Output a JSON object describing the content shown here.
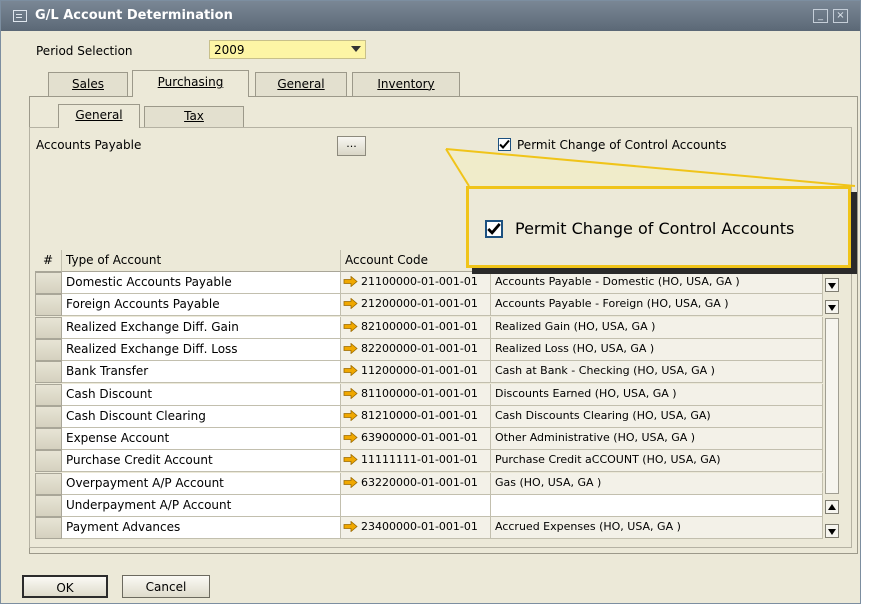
{
  "window": {
    "title": "G/L Account Determination",
    "controls": [
      "_",
      "×"
    ]
  },
  "period": {
    "label": "Period Selection",
    "value": "2009"
  },
  "tabs": [
    {
      "label": "Sales",
      "active": false
    },
    {
      "label": "Purchasing",
      "active": true
    },
    {
      "label": "General",
      "active": false
    },
    {
      "label": "Inventory",
      "active": false
    }
  ],
  "subtabs": [
    {
      "label": "General",
      "active": true
    },
    {
      "label": "Tax",
      "active": false
    }
  ],
  "accounts_payable": {
    "label": "Accounts Payable",
    "button_label": "..."
  },
  "permit_change": {
    "label": "Permit Change of Control Accounts",
    "checked": true
  },
  "grid": {
    "columns": [
      "#",
      "Type of Account",
      "Account Code",
      ""
    ],
    "rows": [
      {
        "type": "Domestic Accounts Payable",
        "code": "21100000-01-001-01",
        "name": "Accounts Payable - Domestic (HO, USA, GA )"
      },
      {
        "type": "Foreign Accounts Payable",
        "code": "21200000-01-001-01",
        "name": "Accounts Payable - Foreign (HO, USA, GA )"
      },
      {
        "type": "Realized Exchange Diff. Gain",
        "code": "82100000-01-001-01",
        "name": "Realized Gain (HO, USA, GA )"
      },
      {
        "type": "Realized Exchange Diff. Loss",
        "code": "82200000-01-001-01",
        "name": "Realized Loss (HO, USA, GA )"
      },
      {
        "type": "Bank Transfer",
        "code": "11200000-01-001-01",
        "name": "Cash at Bank - Checking (HO, USA, GA )"
      },
      {
        "type": "Cash Discount",
        "code": "81100000-01-001-01",
        "name": "Discounts Earned (HO, USA, GA )"
      },
      {
        "type": "Cash Discount Clearing",
        "code": "81210000-01-001-01",
        "name": "Cash Discounts Clearing (HO, USA, GA)"
      },
      {
        "type": "Expense Account",
        "code": "63900000-01-001-01",
        "name": "Other Administrative (HO, USA, GA )"
      },
      {
        "type": "Purchase Credit Account",
        "code": "11111111-01-001-01",
        "name": "Purchase Credit aCCOUNT (HO, USA, GA)"
      },
      {
        "type": "Overpayment A/P Account",
        "code": "63220000-01-001-01",
        "name": "Gas (HO, USA, GA )"
      },
      {
        "type": "Underpayment A/P Account",
        "code": "",
        "name": ""
      },
      {
        "type": "Payment Advances",
        "code": "23400000-01-001-01",
        "name": "Accrued Expenses (HO, USA, GA )"
      }
    ]
  },
  "buttons": {
    "ok": "OK",
    "cancel": "Cancel"
  },
  "colors": {
    "period_field": "#fdf5a5",
    "callout_border": "#f0c419",
    "link_arrow": "#f0a800"
  }
}
